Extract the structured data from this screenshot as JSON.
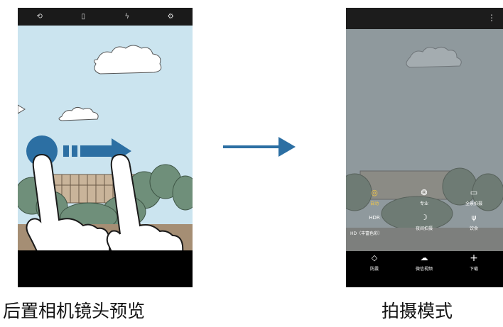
{
  "left_phone": {
    "toolbar_icons": [
      "camera-switch-icon",
      "ratio-icon",
      "flash-off-icon",
      "settings-icon"
    ],
    "toolbar_glyphs": [
      "⟲",
      "▯",
      "ϟ",
      "⚙"
    ],
    "gesture": "swipe-right",
    "caption": "后置相机镜头预览"
  },
  "arrow_between": "right",
  "right_phone": {
    "menu_glyph": "⋮",
    "modes": [
      {
        "label": "自动",
        "icon": "camera-icon",
        "glyph": "◎",
        "selected": true
      },
      {
        "label": "专业",
        "icon": "aperture-icon",
        "glyph": "❂",
        "selected": false
      },
      {
        "label": "全景拍摄",
        "icon": "panorama-icon",
        "glyph": "▭",
        "selected": false
      },
      {
        "label": "HDR",
        "icon": "hdr-icon",
        "glyph": "HDR",
        "selected": false
      },
      {
        "label": "夜间拍摄",
        "icon": "moon-icon",
        "glyph": "☽",
        "selected": false
      },
      {
        "label": "饮食",
        "icon": "fork-knife-icon",
        "glyph": "ψ",
        "selected": false
      },
      {
        "label": "防震",
        "icon": "stabilize-icon",
        "glyph": "◇",
        "selected": false
      },
      {
        "label": "微信视频",
        "icon": "video-chat-icon",
        "glyph": "☁",
        "selected": false
      },
      {
        "label": "下载",
        "icon": "plus-icon",
        "glyph": "+",
        "selected": false
      }
    ],
    "hd_label": "HD（丰富色彩）",
    "caption": "拍摄模式"
  },
  "colors": {
    "sky": "#cbe4ef",
    "overlay": "#8f999d",
    "arrow": "#2c6fa3",
    "selected": "#f2c744"
  }
}
